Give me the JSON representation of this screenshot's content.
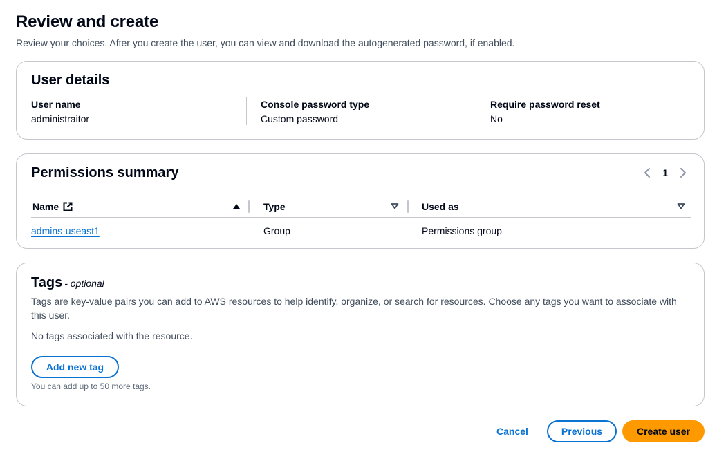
{
  "header": {
    "title": "Review and create",
    "description": "Review your choices. After you create the user, you can view and download the autogenerated password, if enabled."
  },
  "user_details": {
    "title": "User details",
    "fields": [
      {
        "label": "User name",
        "value": "administraitor"
      },
      {
        "label": "Console password type",
        "value": "Custom password"
      },
      {
        "label": "Require password reset",
        "value": "No"
      }
    ]
  },
  "permissions": {
    "title": "Permissions summary",
    "page": "1",
    "columns": [
      {
        "label": "Name",
        "icon": "external-link-icon",
        "sort": "ascending"
      },
      {
        "label": "Type",
        "sort": "none"
      },
      {
        "label": "Used as",
        "sort": "none"
      }
    ],
    "rows": [
      {
        "name": "admins-useast1",
        "type": "Group",
        "used_as": "Permissions group"
      }
    ]
  },
  "tags": {
    "title": "Tags",
    "optional": "- optional",
    "description": "Tags are key-value pairs you can add to AWS resources to help identify, organize, or search for resources. Choose any tags you want to associate with this user.",
    "empty": "No tags associated with the resource.",
    "add_button": "Add new tag",
    "hint": "You can add up to 50 more tags."
  },
  "footer": {
    "cancel": "Cancel",
    "previous": "Previous",
    "create": "Create user"
  },
  "colors": {
    "link": "#0972d3",
    "primary": "#ff9900",
    "border": "#c6c6cd",
    "text": "#000716"
  }
}
